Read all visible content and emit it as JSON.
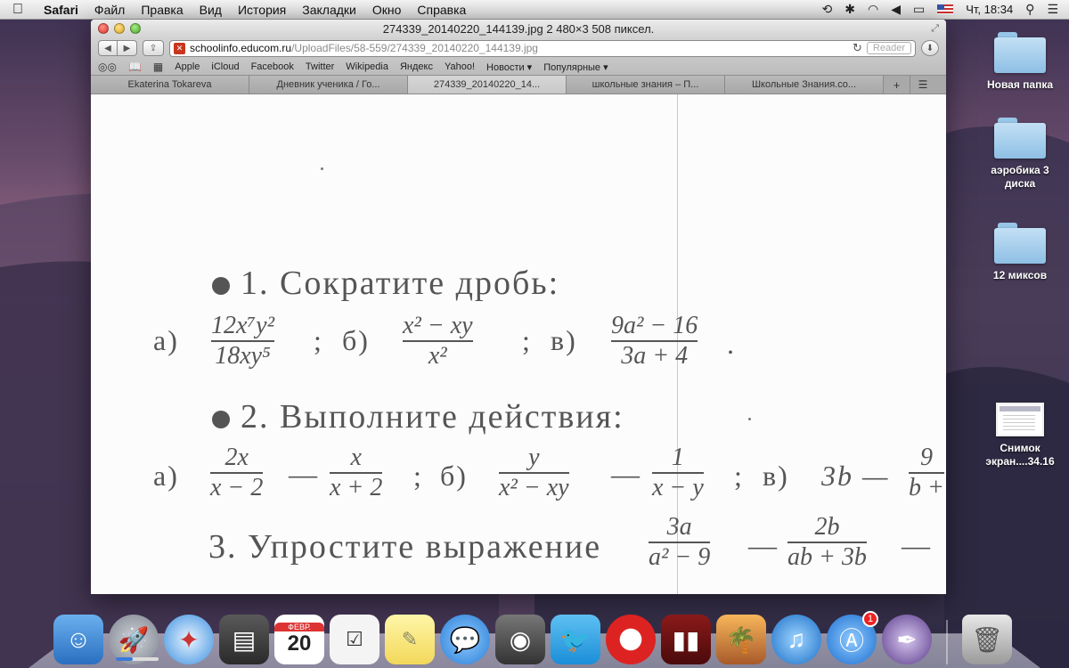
{
  "menubar": {
    "apple": "",
    "items": [
      "Safari",
      "Файл",
      "Правка",
      "Вид",
      "История",
      "Закладки",
      "Окно",
      "Справка"
    ],
    "clock": "Чт, 18:34"
  },
  "window": {
    "title": "274339_20140220_144139.jpg 2 480×3 508 пиксел.",
    "url_host": "schoolinfo.educom.ru",
    "url_path": "/UploadFiles/58-559/274339_20140220_144139.jpg",
    "reader": "Reader",
    "bookmarks": [
      "Apple",
      "iCloud",
      "Facebook",
      "Twitter",
      "Wikipedia",
      "Яндекс",
      "Yahoo!",
      "Новости ▾",
      "Популярные ▾"
    ],
    "tabs": [
      {
        "label": "Ekaterina Tokareva"
      },
      {
        "label": "Дневник ученика / Го..."
      },
      {
        "label": "274339_20140220_14..."
      },
      {
        "label": "школьные знания – П..."
      },
      {
        "label": "Школьные Знания.co..."
      }
    ],
    "active_tab": 2
  },
  "doc": {
    "task1": "1. Сократите дробь:",
    "a": "а)",
    "b": "б)",
    "v": "в)",
    "sep1": ";",
    "sep2": ";",
    "end": ".",
    "f1_num": "12x⁷y²",
    "f1_den": "18xy⁵",
    "f2_num": "x² − xy",
    "f2_den": "x²",
    "f3_num": "9a² − 16",
    "f3_den": "3a + 4",
    "task2": "2. Выполните действия:",
    "g1_num": "2x",
    "g1_den": "x − 2",
    "minus": "—",
    "g2_num": "x",
    "g2_den": "x + 2",
    "g3_num": "y",
    "g3_den": "x² − xy",
    "g4_num": "1",
    "g4_den": "x − y",
    "g5_pre": "3b —",
    "g5_num": "9",
    "g5_den": "b +",
    "task3": "3. Упростите выражение",
    "h1_num": "3a",
    "h1_den": "a² − 9",
    "h2_num": "2b",
    "h2_den": "ab + 3b"
  },
  "desktop": {
    "icons": [
      {
        "label": "Новая папка"
      },
      {
        "label": "аэробика 3 диска"
      },
      {
        "label": "12 миксов"
      },
      {
        "label": "Снимок экран....34.16"
      }
    ]
  },
  "dock": {
    "calendar_month": "ФЕВР.",
    "calendar_day": "20",
    "appstore_badge": "1",
    "download_progress": 0.4
  }
}
